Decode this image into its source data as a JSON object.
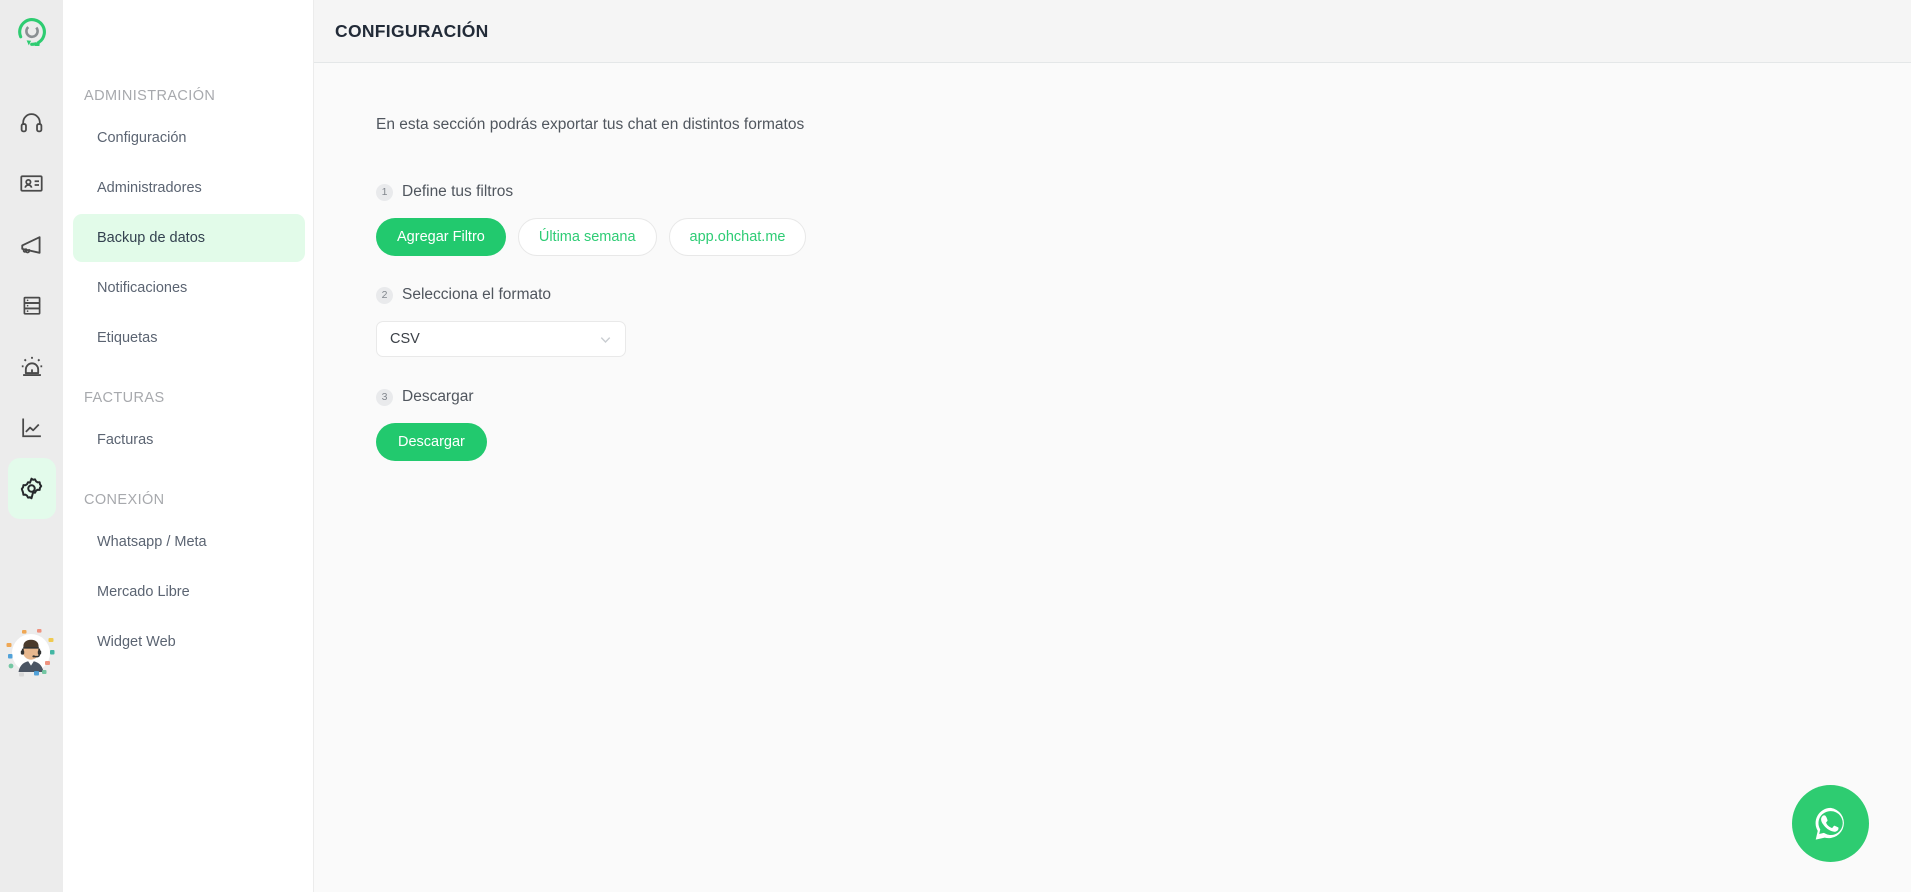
{
  "brand": {
    "logo_icon": "chat-bubble-c-logo",
    "accent_color": "#22c96e",
    "accent_light_color": "#e2fbe9",
    "chip_text_color": "#2ecc75"
  },
  "rail": {
    "items": [
      {
        "icon": "headset-icon",
        "name": "conversations"
      },
      {
        "icon": "contact-card-icon",
        "name": "contacts"
      },
      {
        "icon": "megaphone-icon",
        "name": "campaigns"
      },
      {
        "icon": "server-list-icon",
        "name": "catalog"
      },
      {
        "icon": "alarm-siren-icon",
        "name": "alerts"
      },
      {
        "icon": "line-chart-icon",
        "name": "reports"
      },
      {
        "icon": "gear-icon",
        "name": "settings",
        "active": true
      }
    ],
    "avatar_icon": "support-agent-avatar"
  },
  "header": {
    "title": "CONFIGURACIÓN"
  },
  "sidebar": {
    "groups": [
      {
        "title": "ADMINISTRACIÓN",
        "items": [
          {
            "label": "Configuración",
            "active": false
          },
          {
            "label": "Administradores",
            "active": false
          },
          {
            "label": "Backup de datos",
            "active": true
          },
          {
            "label": "Notificaciones",
            "active": false
          },
          {
            "label": "Etiquetas",
            "active": false
          }
        ]
      },
      {
        "title": "FACTURAS",
        "items": [
          {
            "label": "Facturas",
            "active": false
          }
        ]
      },
      {
        "title": "CONEXIÓN",
        "items": [
          {
            "label": "Whatsapp / Meta",
            "active": false
          },
          {
            "label": "Mercado Libre",
            "active": false
          },
          {
            "label": "Widget Web",
            "active": false
          }
        ]
      }
    ]
  },
  "main": {
    "intro": "En esta sección podrás exportar tus chat en distintos formatos",
    "step1": {
      "number": "1",
      "label": "Define tus filtros",
      "add_filter_button": "Agregar Filtro",
      "chips": [
        {
          "label": "Última semana"
        },
        {
          "label": "app.ohchat.me"
        }
      ]
    },
    "step2": {
      "number": "2",
      "label": "Selecciona el formato",
      "format_selected": "CSV",
      "format_options": [
        "CSV"
      ],
      "chevron_icon": "chevron-down-icon"
    },
    "step3": {
      "number": "3",
      "label": "Descargar",
      "download_button": "Descargar"
    }
  },
  "fab": {
    "icon": "whatsapp-icon",
    "color": "#2ecc71"
  }
}
